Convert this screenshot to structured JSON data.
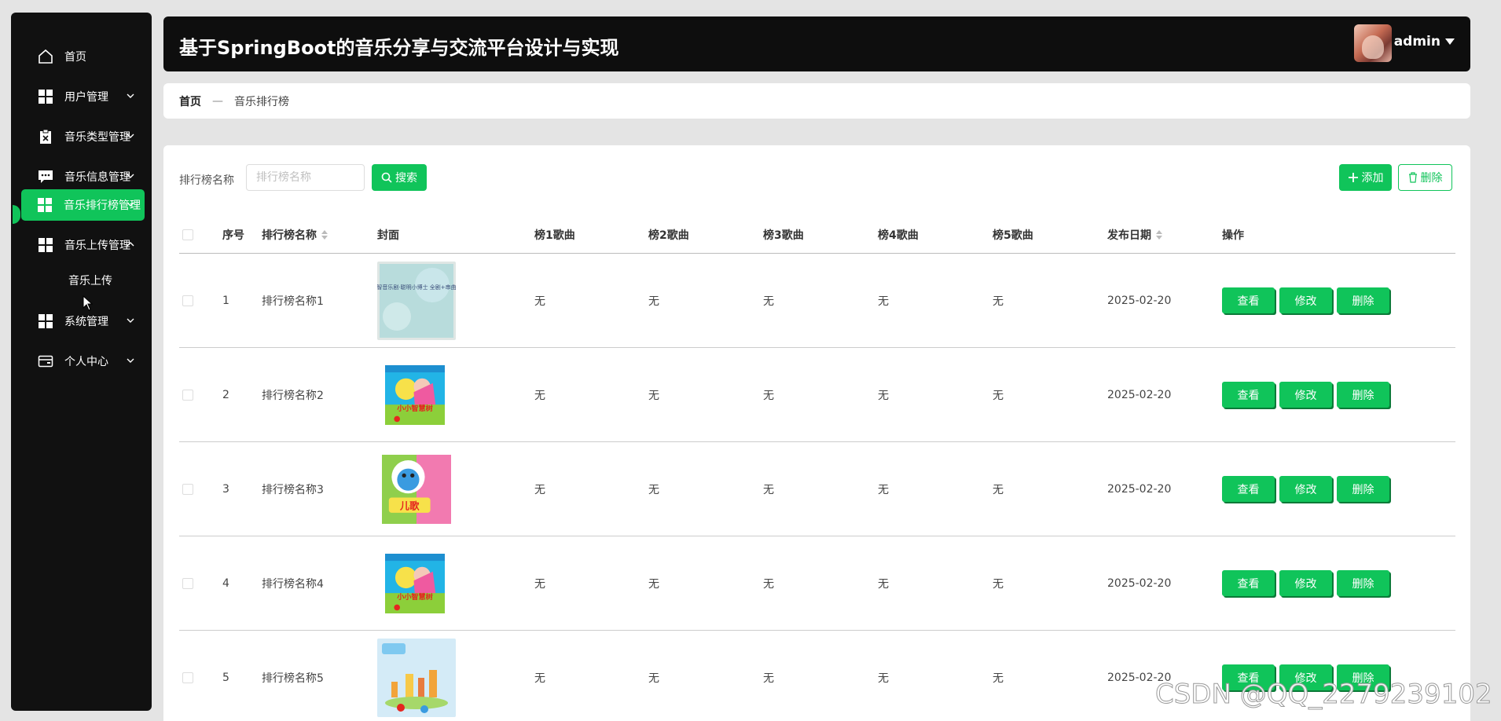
{
  "header": {
    "title": "基于SpringBoot的音乐分享与交流平台设计与实现",
    "user": "admin"
  },
  "sidebar": {
    "items": [
      {
        "label": "首页",
        "icon": "home-icon"
      },
      {
        "label": "用户管理",
        "icon": "grid-icon"
      },
      {
        "label": "音乐类型管理",
        "icon": "clipboard-icon"
      },
      {
        "label": "音乐信息管理",
        "icon": "chat-icon"
      },
      {
        "label": "音乐排行榜管理",
        "icon": "grid-icon",
        "active": true
      },
      {
        "label": "音乐上传管理",
        "icon": "grid-icon",
        "expanded": true
      },
      {
        "label": "系统管理",
        "icon": "grid-icon"
      },
      {
        "label": "个人中心",
        "icon": "wallet-icon"
      }
    ],
    "sub_item": "音乐上传"
  },
  "breadcrumb": {
    "home": "首页",
    "separator": "—",
    "current": "音乐排行榜"
  },
  "search": {
    "label": "排行榜名称",
    "placeholder": "排行榜名称",
    "button": "搜索"
  },
  "toolbar": {
    "add": "添加",
    "delete": "删除"
  },
  "table": {
    "columns": [
      "序号",
      "排行榜名称",
      "封面",
      "榜1歌曲",
      "榜2歌曲",
      "榜3歌曲",
      "榜4歌曲",
      "榜5歌曲",
      "发布日期",
      "操作"
    ],
    "rows": [
      {
        "no": "1",
        "name": "排行榜名称1",
        "cover_text": "益智音乐剧·聪明小博士 全剧+串曲集",
        "s1": "无",
        "s2": "无",
        "s3": "无",
        "s4": "无",
        "s5": "无",
        "date": "2025-02-20"
      },
      {
        "no": "2",
        "name": "排行榜名称2",
        "cover_text": "小小智慧树",
        "s1": "无",
        "s2": "无",
        "s3": "无",
        "s4": "无",
        "s5": "无",
        "date": "2025-02-20"
      },
      {
        "no": "3",
        "name": "排行榜名称3",
        "cover_text": "儿歌",
        "s1": "无",
        "s2": "无",
        "s3": "无",
        "s4": "无",
        "s5": "无",
        "date": "2025-02-20"
      },
      {
        "no": "4",
        "name": "排行榜名称4",
        "cover_text": "小小智慧树",
        "s1": "无",
        "s2": "无",
        "s3": "无",
        "s4": "无",
        "s5": "无",
        "date": "2025-02-20"
      },
      {
        "no": "5",
        "name": "排行榜名称5",
        "cover_text": "",
        "s1": "无",
        "s2": "无",
        "s3": "无",
        "s4": "无",
        "s5": "无",
        "date": "2025-02-20"
      }
    ],
    "actions": {
      "view": "查看",
      "edit": "修改",
      "delete": "删除"
    }
  },
  "watermark": "CSDN @QQ_2279239102",
  "colors": {
    "accent": "#10c45a",
    "sidebar_bg": "#111111",
    "header_bg": "#0e0e0e"
  }
}
